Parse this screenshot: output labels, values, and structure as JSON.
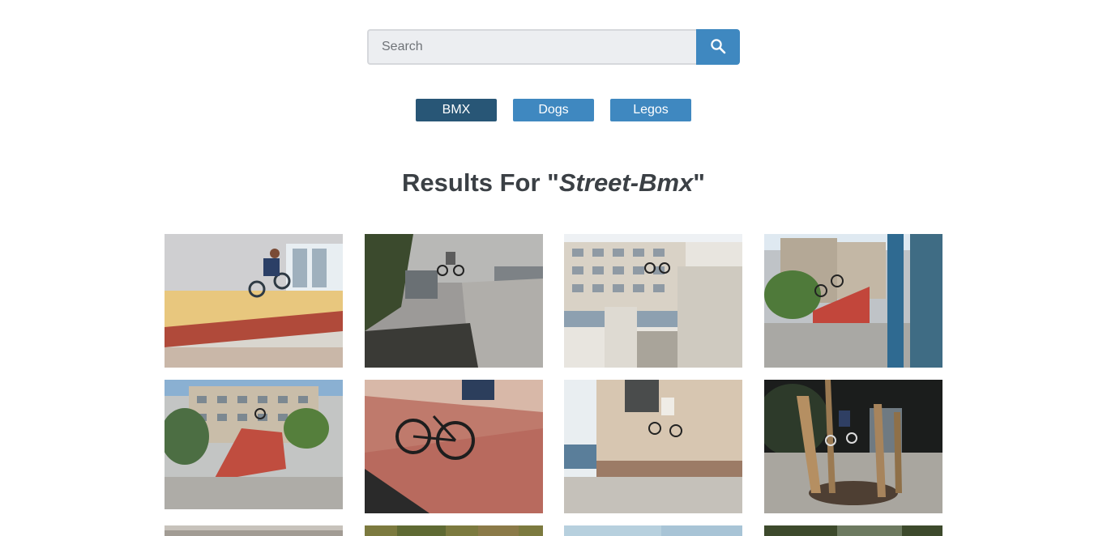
{
  "search": {
    "placeholder": "Search",
    "value": "",
    "button_icon": "search-icon",
    "accent_color": "#3f88c0"
  },
  "categories": [
    {
      "label": "BMX",
      "active": true
    },
    {
      "label": "Dogs",
      "active": false
    },
    {
      "label": "Legos",
      "active": false
    }
  ],
  "results": {
    "prefix": "Results For \"",
    "query": "Street-Bmx",
    "suffix": "\""
  },
  "gallery": {
    "photos": [
      {
        "subject": "bmx-rider-wall-ride"
      },
      {
        "subject": "bmx-rider-wall-jump"
      },
      {
        "subject": "bmx-rider-building-jump"
      },
      {
        "subject": "bmx-rider-ramp"
      },
      {
        "subject": "bmx-rider-ramp-through-fence"
      },
      {
        "subject": "bmx-bike-closeup-ramp"
      },
      {
        "subject": "bmx-rider-wall-tap"
      },
      {
        "subject": "bmx-rider-night-wood"
      },
      {
        "subject": "bmx-photo"
      },
      {
        "subject": "bmx-photo"
      },
      {
        "subject": "bmx-photo"
      },
      {
        "subject": "bmx-photo"
      }
    ]
  }
}
